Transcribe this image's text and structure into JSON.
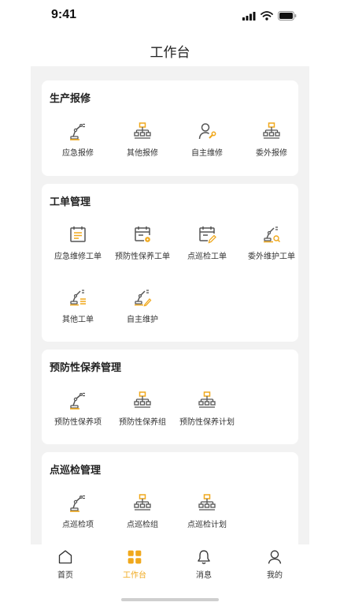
{
  "status": {
    "time": "9:41"
  },
  "header": {
    "title": "工作台"
  },
  "colors": {
    "accent": "#f0a81c",
    "icon_gray": "#555555",
    "background": "#f2f2f2"
  },
  "sections": [
    {
      "title": "生产报修",
      "items": [
        {
          "label": "应急报修",
          "icon": "robot-arm-icon"
        },
        {
          "label": "其他报修",
          "icon": "org-chart-icon"
        },
        {
          "label": "自主维修",
          "icon": "user-wrench-icon"
        },
        {
          "label": "委外报修",
          "icon": "org-chart-icon"
        }
      ]
    },
    {
      "title": "工单管理",
      "items": [
        {
          "label": "应急维修工单",
          "icon": "list-document-icon"
        },
        {
          "label": "预防性保养工单",
          "icon": "calendar-gear-icon"
        },
        {
          "label": "点巡检工单",
          "icon": "calendar-edit-icon"
        },
        {
          "label": "委外维护工单",
          "icon": "robot-arm-search-icon"
        },
        {
          "label": "其他工单",
          "icon": "robot-arm-list-icon"
        },
        {
          "label": "自主维护",
          "icon": "robot-arm-edit-icon"
        }
      ]
    },
    {
      "title": "预防性保养管理",
      "items": [
        {
          "label": "预防性保养项",
          "icon": "robot-arm-icon"
        },
        {
          "label": "预防性保养组",
          "icon": "org-chart-icon"
        },
        {
          "label": "预防性保养计划",
          "icon": "org-chart-icon"
        }
      ]
    },
    {
      "title": "点巡检管理",
      "items": [
        {
          "label": "点巡检项",
          "icon": "robot-arm-icon"
        },
        {
          "label": "点巡检组",
          "icon": "org-chart-icon"
        },
        {
          "label": "点巡检计划",
          "icon": "org-chart-icon"
        }
      ]
    }
  ],
  "tabbar": [
    {
      "label": "首页",
      "icon": "home-icon"
    },
    {
      "label": "工作台",
      "icon": "workbench-icon",
      "active": true
    },
    {
      "label": "消息",
      "icon": "bell-icon"
    },
    {
      "label": "我的",
      "icon": "user-icon"
    }
  ]
}
